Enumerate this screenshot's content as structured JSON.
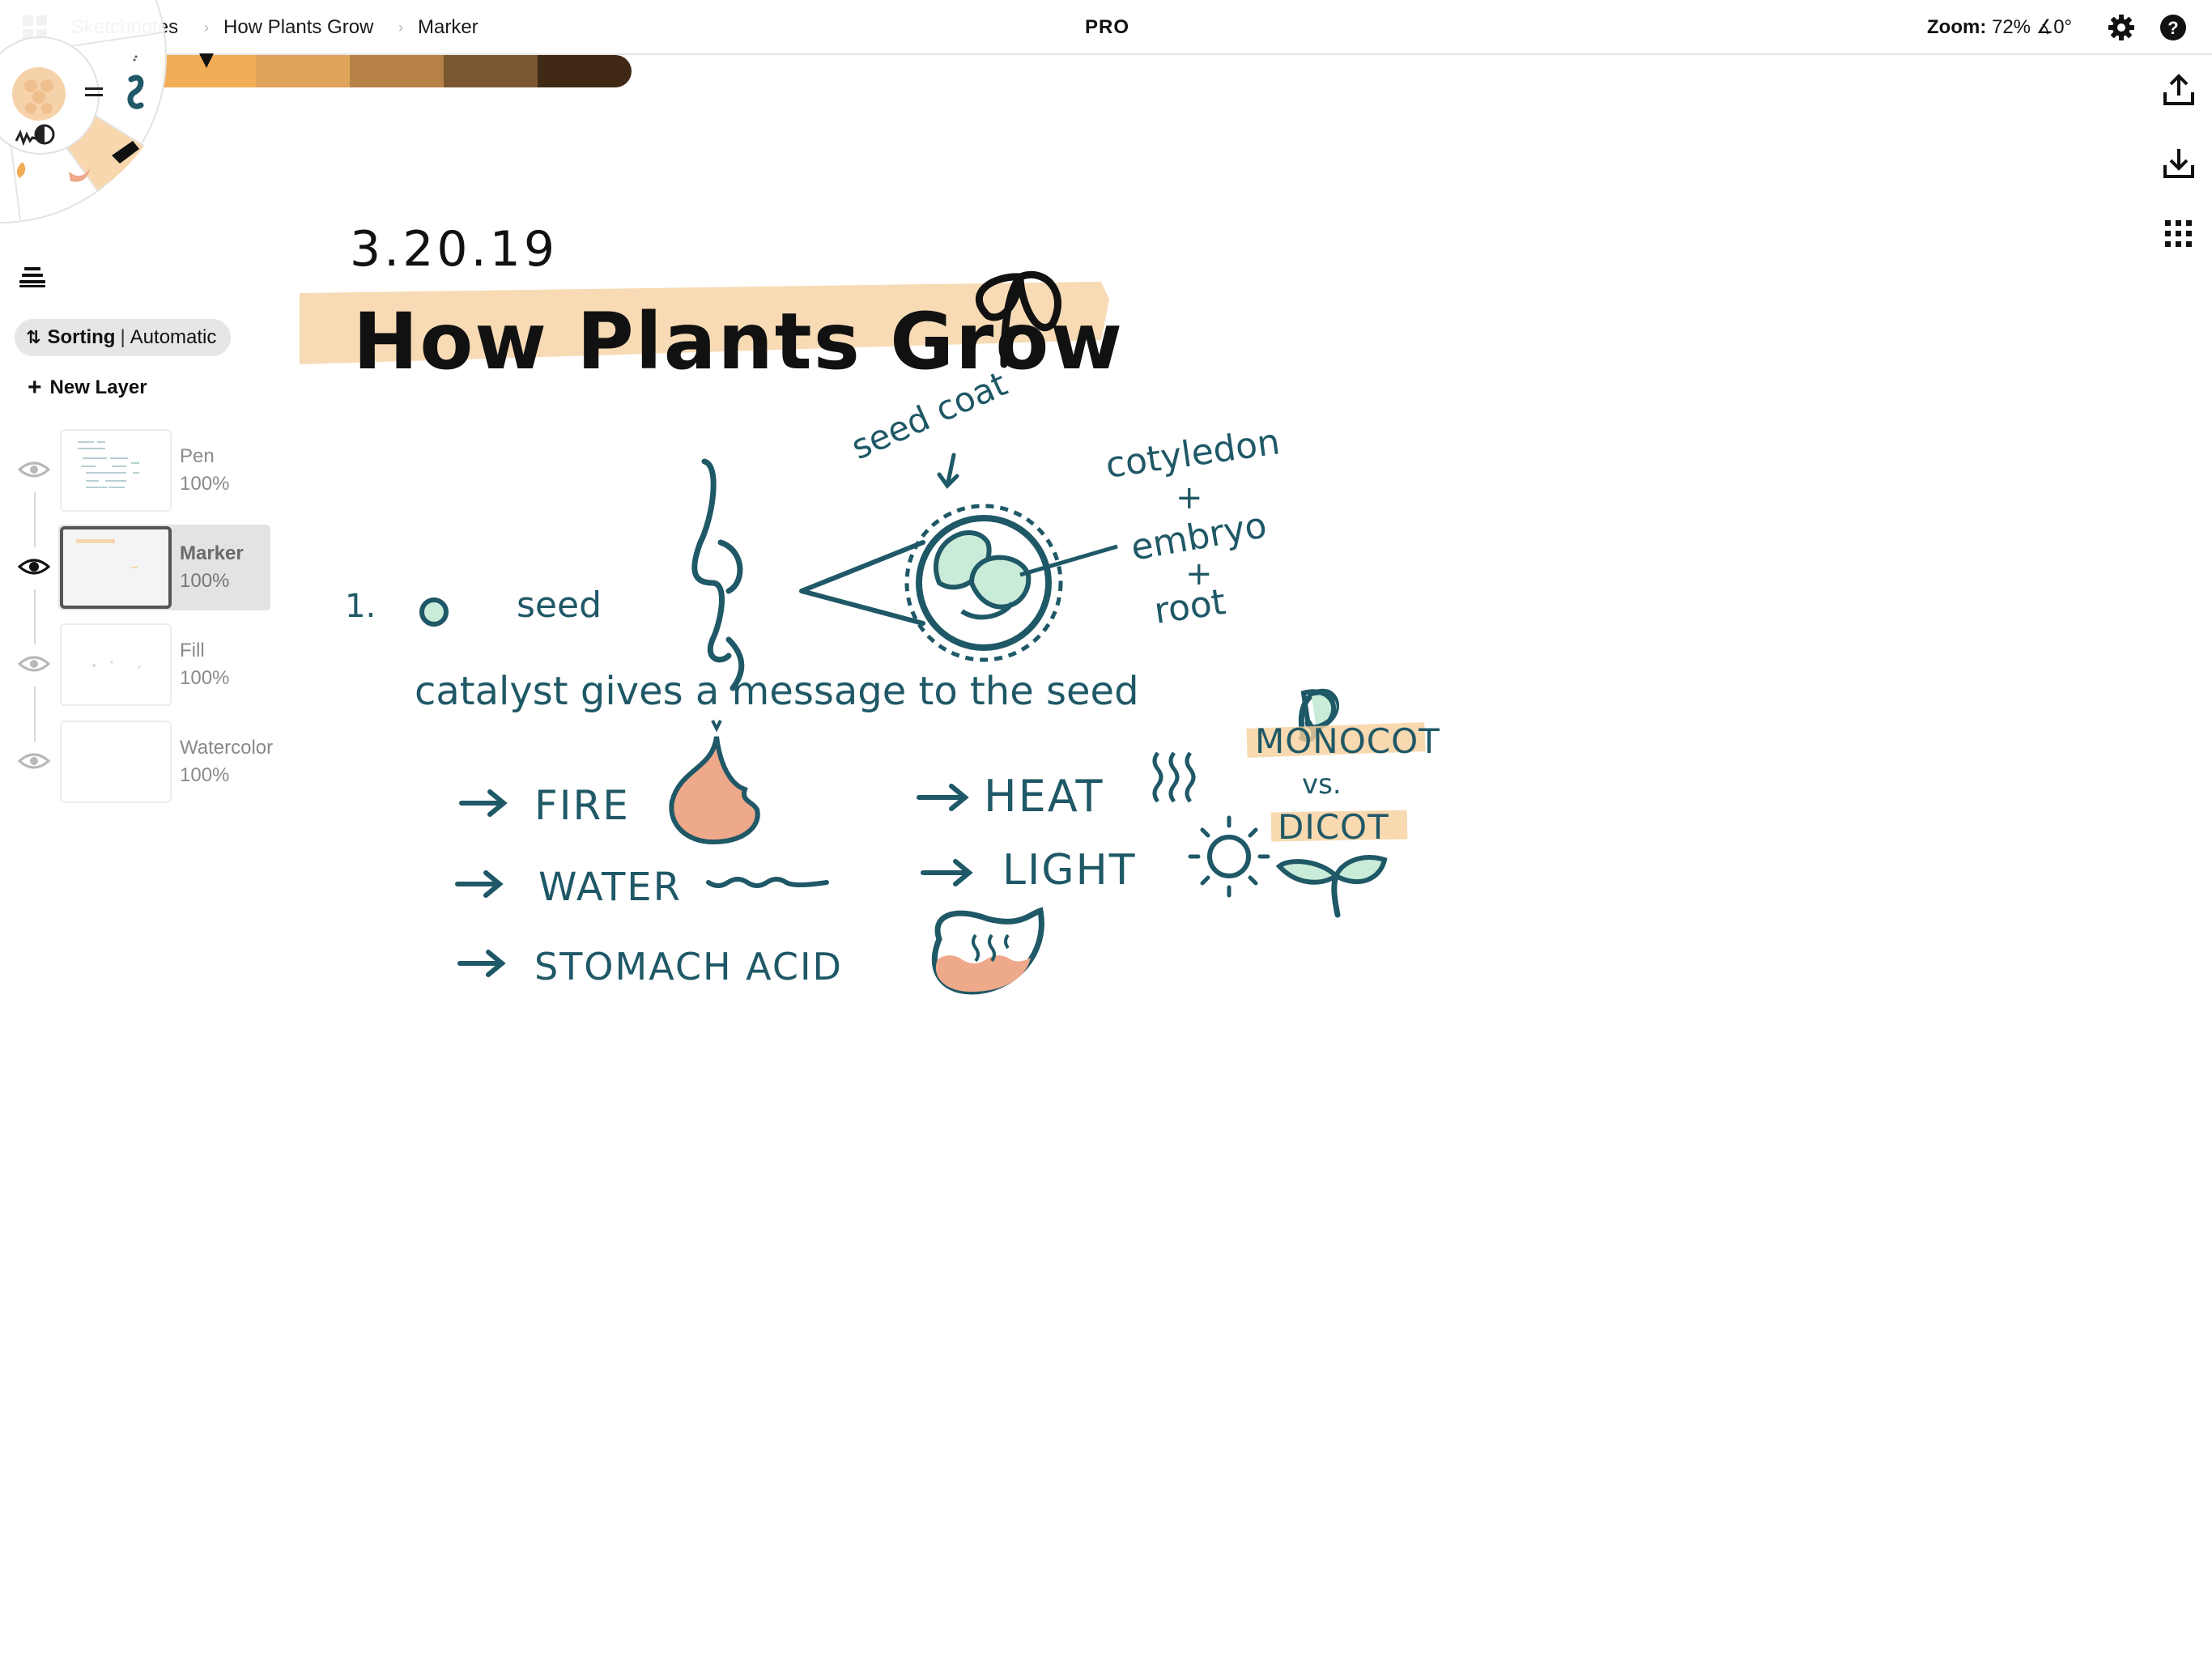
{
  "topbar": {
    "grid_icon": "app-grid-icon",
    "breadcrumbs": [
      "Sketchnotes",
      "How Plants Grow",
      "Marker"
    ],
    "pro_label": "PRO",
    "zoom_label": "Zoom:",
    "zoom_value": "72% ∡0°",
    "settings_icon": "gear-icon",
    "help_icon": "help-icon"
  },
  "palette": {
    "colors": [
      "#f2ad57",
      "#dfa35a",
      "#b58147",
      "#7a5730",
      "#402a15"
    ]
  },
  "tool_wheel": {
    "icons": [
      "brush-swatch-icon",
      "equals-icon",
      "curve-stroke-icon",
      "pressure-icon",
      "contrast-icon",
      "marker-tool-icon",
      "color-blob-icon"
    ]
  },
  "layers_panel": {
    "layers_icon": "layers-icon",
    "sorting_label": "Sorting",
    "sorting_value": "Automatic",
    "new_layer_label": "New Layer",
    "layers": [
      {
        "name": "Pen",
        "opacity": "100%",
        "visible": false,
        "selected": false
      },
      {
        "name": "Marker",
        "opacity": "100%",
        "visible": true,
        "selected": true
      },
      {
        "name": "Fill",
        "opacity": "100%",
        "visible": false,
        "selected": false
      },
      {
        "name": "Watercolor",
        "opacity": "100%",
        "visible": false,
        "selected": false
      }
    ]
  },
  "right_toolbar": {
    "icons": [
      "export-icon",
      "import-icon",
      "grid-dots-icon"
    ]
  },
  "canvas_notes": {
    "date": "3.20.19",
    "title": "How Plants Grow",
    "step_number": "1.",
    "seed_label": "seed",
    "seed_coat_label": "seed coat",
    "cotyledon_label": "cotyledon",
    "plus_1": "+",
    "embryo_label": "embryo",
    "plus_2": "+",
    "root_label": "root",
    "catalyst_text": "catalyst gives a message to the seed",
    "triggers": [
      "FIRE",
      "WATER",
      "STOMACH ACID",
      "HEAT",
      "LIGHT"
    ],
    "monocot_label": "MONOCOT",
    "vs_label": "vs.",
    "dicot_label": "DICOT",
    "ink_color": "#1f5866",
    "highlight_color": "#f5c98f",
    "fill_green": "#c9ecd9",
    "fill_salmon": "#eea88a"
  }
}
